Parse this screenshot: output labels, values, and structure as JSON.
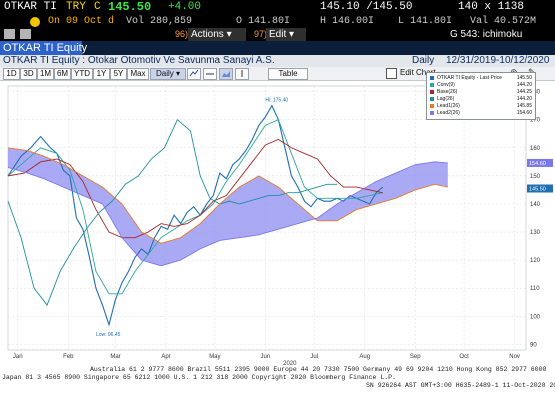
{
  "header": {
    "ticker": "OTKAR TI",
    "currency": "TRY",
    "price_prefix": "C",
    "price": "145.50",
    "change": "+4.00",
    "bid_ask": "145.10 /145.50",
    "size": "140 x 1138",
    "date_label": "On 09 Oct d",
    "volume": "Vol 280,859",
    "open": "O 141.80I",
    "high": "H 146.00I",
    "low": "L 141.80I",
    "val": "Val 40.572M"
  },
  "toolbar": {
    "actions_num": "96)",
    "actions_label": "Actions ▾",
    "edit_num": "97)",
    "edit_label": "Edit ▾",
    "page_label": "G 543: ichimoku"
  },
  "security": {
    "name": "OTKAR TI Equity",
    "description": "OTKAR TI Equity : Otokar Otomotiv Ve Savunma Sanayi A.S.",
    "frequency": "Daily",
    "range": "12/31/2019-10/12/2020"
  },
  "controls": {
    "periods": [
      "1D",
      "3D",
      "1M",
      "6M",
      "YTD",
      "1Y",
      "5Y",
      "Max"
    ],
    "frequency_select": "Daily ▾",
    "table_label": "Table",
    "edit_chart_label": "Edit Chart"
  },
  "legend": [
    {
      "name": "OTKAR TI Equity - Last Price",
      "value": "145.50",
      "color": "#1f6fb2"
    },
    {
      "name": "Conv(9)",
      "value": "144.20",
      "color": "#2aa6a0"
    },
    {
      "name": "Base(26)",
      "value": "144.25",
      "color": "#a8242a"
    },
    {
      "name": "Lag(26)",
      "value": "144.20",
      "color": "#1f8f9e"
    },
    {
      "name": "Lead1(26)",
      "value": "145.85",
      "color": "#e87a2a"
    },
    {
      "name": "Lead2(26)",
      "value": "154.60",
      "color": "#7b78e8"
    }
  ],
  "annotations": {
    "high": "Hi: 175.40",
    "low": "Low: 96.45"
  },
  "chart_data": {
    "type": "line",
    "title": "",
    "xlabel": "",
    "ylabel": "",
    "ylim": [
      88,
      182
    ],
    "yticks": [
      90,
      100,
      110,
      120,
      130,
      140,
      150,
      160,
      170,
      180
    ],
    "x_ticks": [
      {
        "label": "Jan",
        "day": 6
      },
      {
        "label": "Feb",
        "day": 37
      },
      {
        "label": "Mar",
        "day": 66
      },
      {
        "label": "Apr",
        "day": 97
      },
      {
        "label": "May",
        "day": 127
      },
      {
        "label": "Jun",
        "day": 158
      },
      {
        "label": "Jul",
        "day": 188
      },
      {
        "label": "Aug",
        "day": 219
      },
      {
        "label": "Sep",
        "day": 250
      },
      {
        "label": "Oct",
        "day": 280
      },
      {
        "label": "Nov",
        "day": 311
      }
    ],
    "x_year_label": "2020",
    "last_price_marker": "145.50",
    "lead2_marker": "154.60",
    "series": [
      {
        "name": "OTKAR TI Equity - Last Price",
        "color": "#1f6fb2",
        "points": [
          [
            0,
            150
          ],
          [
            8,
            157
          ],
          [
            14,
            160
          ],
          [
            20,
            164
          ],
          [
            26,
            160
          ],
          [
            30,
            158
          ],
          [
            34,
            152
          ],
          [
            38,
            150
          ],
          [
            42,
            135
          ],
          [
            46,
            131
          ],
          [
            50,
            121
          ],
          [
            54,
            110
          ],
          [
            58,
            104
          ],
          [
            62,
            97
          ],
          [
            66,
            106
          ],
          [
            70,
            112
          ],
          [
            74,
            116
          ],
          [
            78,
            121
          ],
          [
            82,
            124
          ],
          [
            86,
            122
          ],
          [
            90,
            128
          ],
          [
            94,
            132
          ],
          [
            98,
            131
          ],
          [
            102,
            136
          ],
          [
            106,
            133
          ],
          [
            110,
            137
          ],
          [
            114,
            139
          ],
          [
            118,
            136
          ],
          [
            122,
            140
          ],
          [
            126,
            143
          ],
          [
            130,
            151
          ],
          [
            134,
            149
          ],
          [
            138,
            154
          ],
          [
            142,
            156
          ],
          [
            146,
            159
          ],
          [
            150,
            163
          ],
          [
            154,
            168
          ],
          [
            158,
            171
          ],
          [
            162,
            175
          ],
          [
            166,
            170
          ],
          [
            170,
            160
          ],
          [
            174,
            150
          ],
          [
            178,
            146
          ],
          [
            182,
            141
          ],
          [
            186,
            139
          ],
          [
            190,
            142
          ],
          [
            194,
            141
          ],
          [
            198,
            141
          ],
          [
            202,
            142
          ],
          [
            206,
            141
          ],
          [
            210,
            143
          ],
          [
            214,
            142
          ],
          [
            218,
            141
          ],
          [
            222,
            140
          ],
          [
            226,
            144
          ],
          [
            230,
            146
          ]
        ]
      },
      {
        "name": "Conv(9)",
        "color": "#2aa6a0",
        "points": [
          [
            0,
            150
          ],
          [
            10,
            155
          ],
          [
            20,
            160
          ],
          [
            30,
            158
          ],
          [
            38,
            152
          ],
          [
            46,
            138
          ],
          [
            54,
            116
          ],
          [
            62,
            108
          ],
          [
            70,
            108
          ],
          [
            78,
            116
          ],
          [
            86,
            122
          ],
          [
            94,
            128
          ],
          [
            102,
            131
          ],
          [
            110,
            134
          ],
          [
            118,
            136
          ],
          [
            126,
            140
          ],
          [
            134,
            148
          ],
          [
            142,
            154
          ],
          [
            150,
            161
          ],
          [
            158,
            168
          ],
          [
            166,
            170
          ],
          [
            174,
            158
          ],
          [
            182,
            146
          ],
          [
            190,
            142
          ],
          [
            198,
            142
          ],
          [
            206,
            142
          ],
          [
            214,
            142
          ],
          [
            222,
            143
          ],
          [
            230,
            144
          ]
        ]
      },
      {
        "name": "Base(26)",
        "color": "#a8242a",
        "points": [
          [
            0,
            150
          ],
          [
            10,
            151
          ],
          [
            20,
            155
          ],
          [
            30,
            156
          ],
          [
            38,
            154
          ],
          [
            46,
            148
          ],
          [
            54,
            138
          ],
          [
            62,
            130
          ],
          [
            70,
            128
          ],
          [
            78,
            128
          ],
          [
            86,
            130
          ],
          [
            94,
            133
          ],
          [
            102,
            132
          ],
          [
            110,
            133
          ],
          [
            118,
            136
          ],
          [
            126,
            141
          ],
          [
            134,
            143
          ],
          [
            142,
            149
          ],
          [
            150,
            155
          ],
          [
            158,
            161
          ],
          [
            166,
            163
          ],
          [
            174,
            160
          ],
          [
            182,
            158
          ],
          [
            190,
            156
          ],
          [
            198,
            150
          ],
          [
            206,
            146
          ],
          [
            214,
            146
          ],
          [
            222,
            145
          ],
          [
            230,
            144
          ]
        ]
      },
      {
        "name": "Lag(26)",
        "color": "#1f8f9e",
        "points": [
          [
            0,
            141
          ],
          [
            8,
            128
          ],
          [
            16,
            110
          ],
          [
            24,
            104
          ],
          [
            32,
            116
          ],
          [
            40,
            124
          ],
          [
            48,
            131
          ],
          [
            56,
            137
          ],
          [
            64,
            141
          ],
          [
            72,
            147
          ],
          [
            80,
            150
          ],
          [
            88,
            156
          ],
          [
            96,
            160
          ],
          [
            104,
            170
          ],
          [
            112,
            166
          ],
          [
            118,
            150
          ],
          [
            124,
            142
          ],
          [
            130,
            140
          ],
          [
            136,
            141
          ],
          [
            142,
            140
          ],
          [
            148,
            141
          ],
          [
            154,
            142
          ],
          [
            160,
            143
          ],
          [
            166,
            143
          ],
          [
            172,
            144
          ],
          [
            178,
            144
          ],
          [
            184,
            145
          ],
          [
            190,
            146
          ],
          [
            196,
            147
          ],
          [
            202,
            147
          ]
        ]
      },
      {
        "name": "Lead1(26)",
        "color": "#e87a2a",
        "points": [
          [
            0,
            160
          ],
          [
            12,
            159
          ],
          [
            22,
            157
          ],
          [
            34,
            154
          ],
          [
            46,
            150
          ],
          [
            58,
            146
          ],
          [
            70,
            140
          ],
          [
            82,
            130
          ],
          [
            94,
            126
          ],
          [
            106,
            128
          ],
          [
            118,
            133
          ],
          [
            130,
            140
          ],
          [
            142,
            146
          ],
          [
            154,
            150
          ],
          [
            166,
            146
          ],
          [
            178,
            140
          ],
          [
            190,
            134
          ],
          [
            202,
            134
          ],
          [
            214,
            138
          ],
          [
            226,
            140
          ],
          [
            238,
            142
          ],
          [
            250,
            145
          ],
          [
            262,
            147
          ],
          [
            270,
            146
          ]
        ]
      },
      {
        "name": "Lead2(26)",
        "color": "#7b78e8",
        "points": [
          [
            0,
            153
          ],
          [
            12,
            151
          ],
          [
            22,
            149
          ],
          [
            34,
            146
          ],
          [
            46,
            143
          ],
          [
            58,
            140
          ],
          [
            70,
            128
          ],
          [
            82,
            120
          ],
          [
            94,
            118
          ],
          [
            106,
            120
          ],
          [
            118,
            124
          ],
          [
            130,
            127
          ],
          [
            142,
            128
          ],
          [
            154,
            129
          ],
          [
            166,
            131
          ],
          [
            178,
            133
          ],
          [
            190,
            135
          ],
          [
            202,
            140
          ],
          [
            214,
            144
          ],
          [
            226,
            148
          ],
          [
            238,
            151
          ],
          [
            250,
            154
          ],
          [
            262,
            155
          ],
          [
            270,
            154.6
          ]
        ]
      }
    ]
  }
}
